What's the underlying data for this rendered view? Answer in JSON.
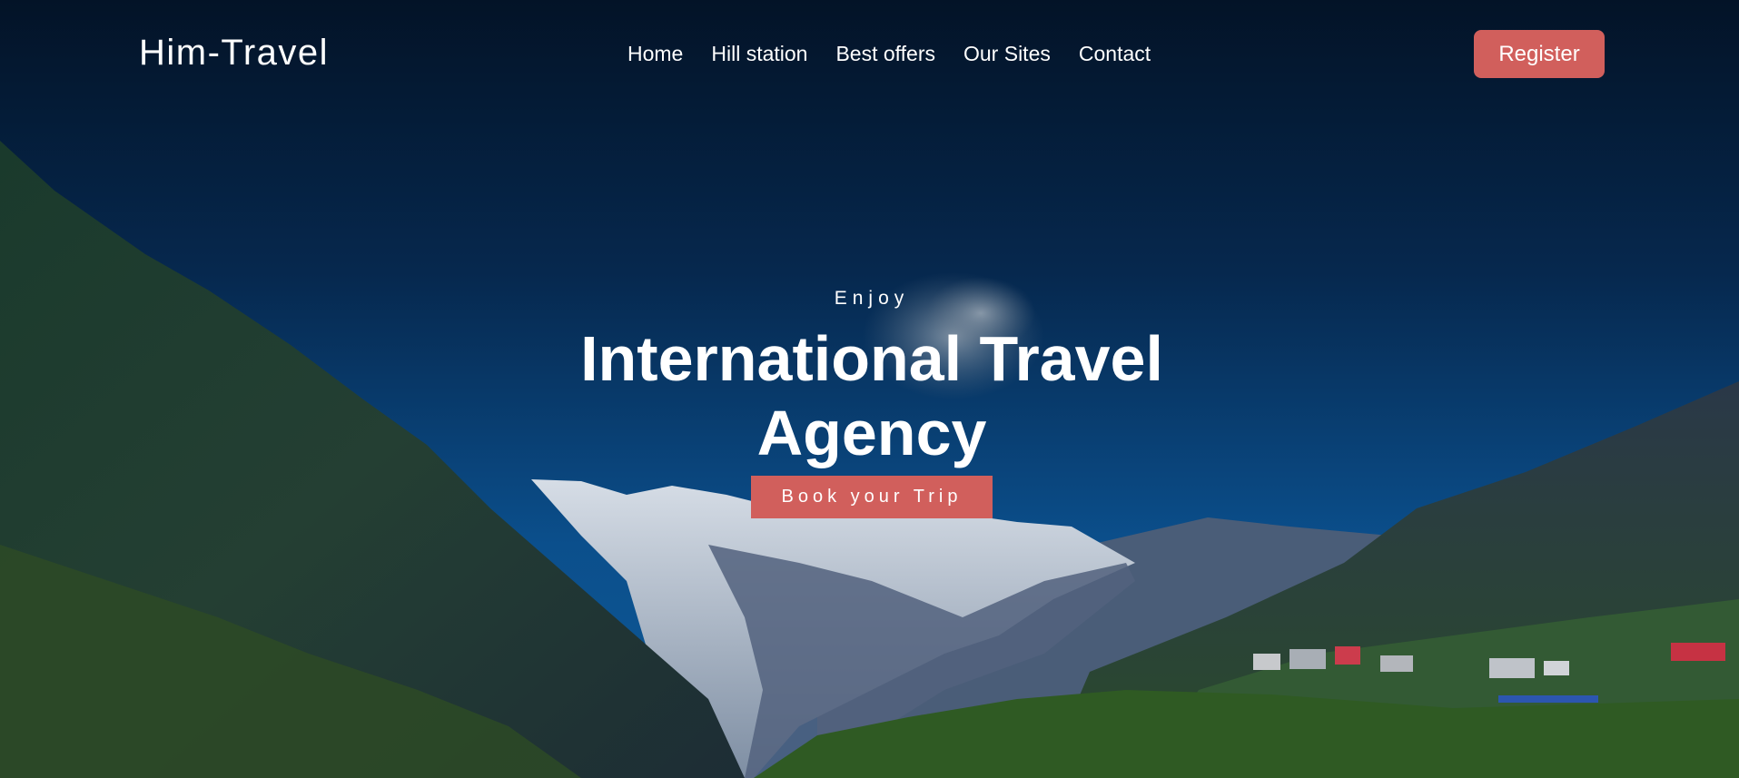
{
  "header": {
    "logo": "Him-Travel",
    "nav": [
      {
        "label": "Home"
      },
      {
        "label": "Hill station"
      },
      {
        "label": "Best offers"
      },
      {
        "label": "Our Sites"
      },
      {
        "label": "Contact"
      }
    ],
    "register_label": "Register"
  },
  "hero": {
    "eyebrow": "Enjoy",
    "title": "International Travel Agency",
    "cta_label": "Book your Trip"
  },
  "colors": {
    "accent": "#d15f5c",
    "sky_top": "#031327",
    "sky_bottom": "#0b4f8c",
    "text": "#ffffff"
  },
  "icons": {
    "background": "mountain-valley-photo"
  }
}
